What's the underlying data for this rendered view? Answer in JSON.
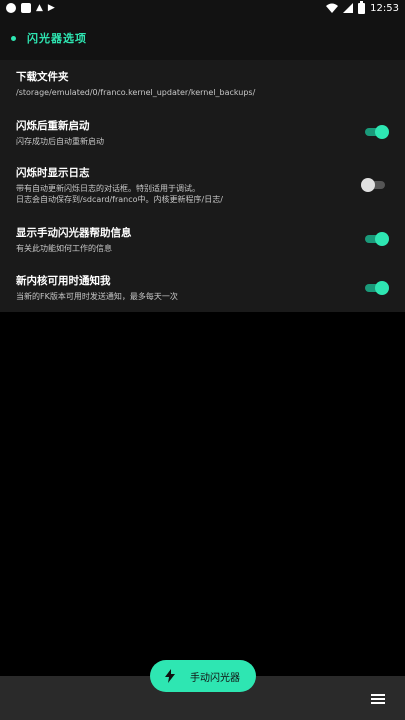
{
  "statusbar": {
    "time": "12:53",
    "icons": [
      "circle-icon",
      "square-icon",
      "a-icon",
      "play-icon",
      "wifi-icon",
      "signal-icon",
      "battery-icon"
    ]
  },
  "section": {
    "title": "闪光器选项"
  },
  "settings": [
    {
      "title": "下载文件夹",
      "subtitle": "/storage/emulated/0/franco.kernel_updater/kernel_backups/",
      "switch": null
    },
    {
      "title": "闪烁后重新启动",
      "subtitle": "闪存成功后自动重新启动",
      "switch": true
    },
    {
      "title": "闪烁时显示日志",
      "subtitle": "带有自动更新闪烁日志的对话框。特别适用于调试。",
      "subtitle2": "日志会自动保存到/sdcard/franco中。内核更新程序/日志/",
      "switch": false
    },
    {
      "title": "显示手动闪光器帮助信息",
      "subtitle": "有关此功能如何工作的信息",
      "switch": true
    },
    {
      "title": "新内核可用时通知我",
      "subtitle": "当新的FK版本可用时发送通知，最多每天一次",
      "switch": true
    }
  ],
  "fab": {
    "label": "手动闪光器",
    "icon": "lightning-icon"
  },
  "bottombar": {
    "icon": "menu-icon"
  },
  "colors": {
    "accent": "#2ee6b2",
    "card": "#1a1a1a",
    "header": "#121212",
    "bottombar": "#2a2a2a"
  }
}
